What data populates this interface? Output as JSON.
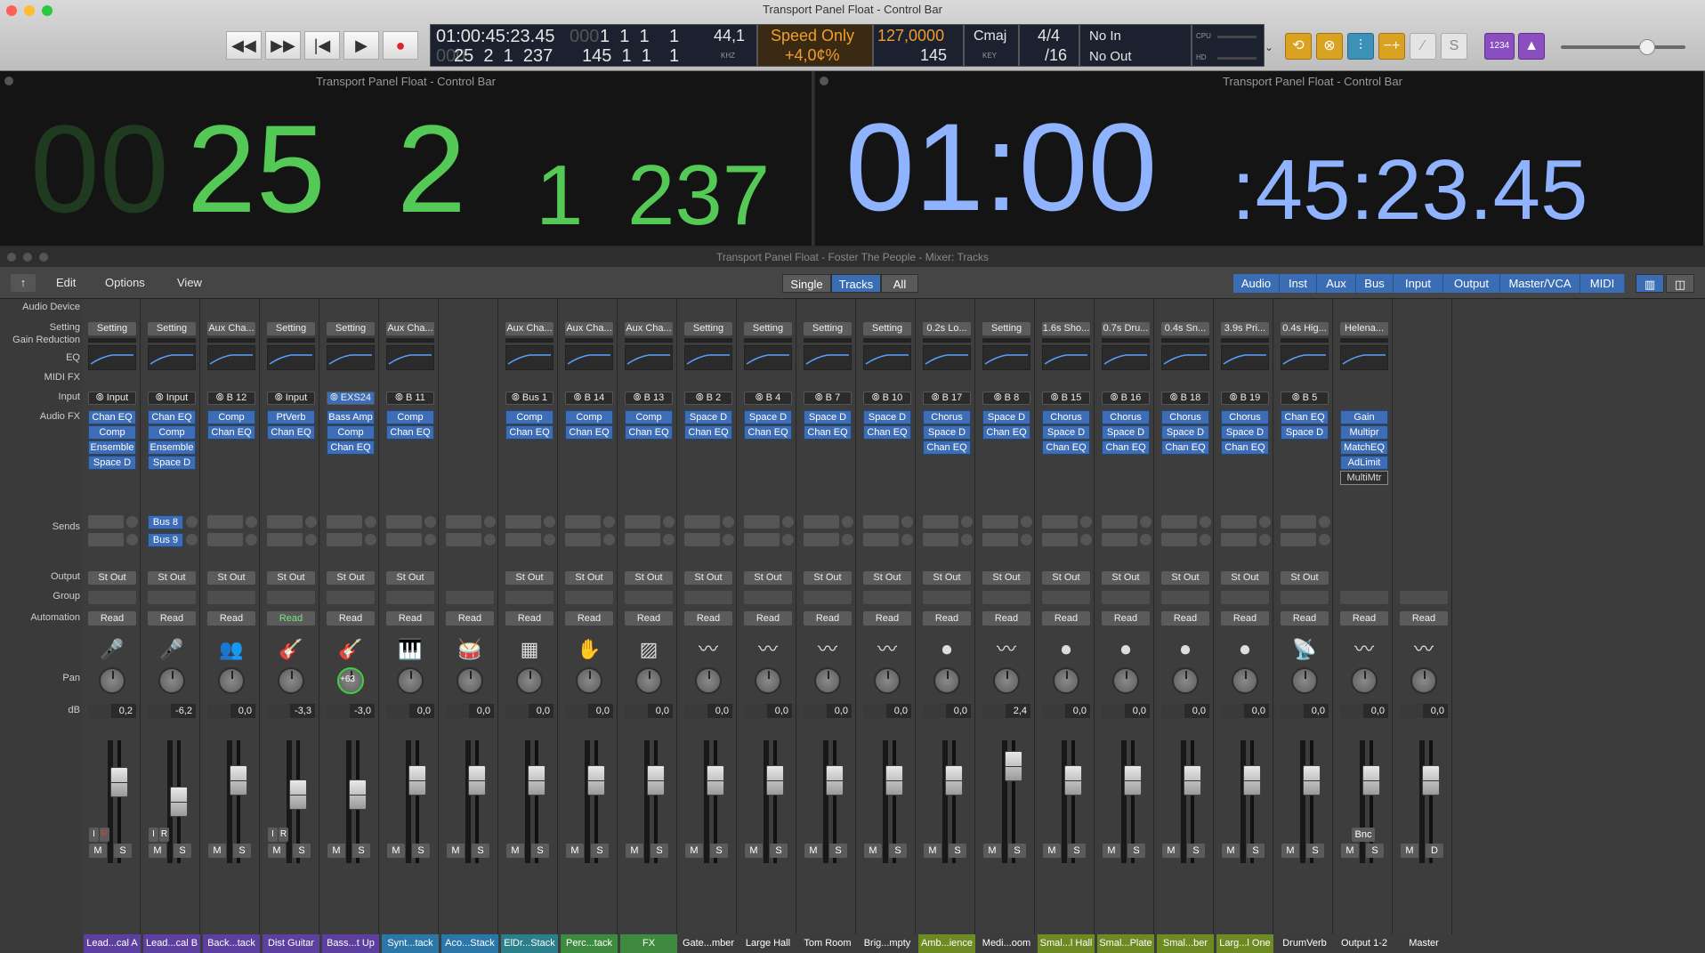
{
  "control_bar": {
    "title": "Transport Panel Float - Control Bar",
    "time": {
      "smpte": "01:00:45:23.45",
      "smpte_dim": "",
      "bar_top": "1  1  1",
      "bar_top_dim": "000",
      "bar_top_last": "1",
      "bar_bot": "145  1  1",
      "bar_bot_last": "1",
      "pos": "25  2  1  237",
      "pos_dim": "000"
    },
    "sample_rate": {
      "value": "44,1",
      "unit": "KHZ"
    },
    "speed": {
      "label": "Speed Only",
      "value": "+4,0¢%"
    },
    "tempo": {
      "top": "127,0000",
      "bottom": "145"
    },
    "key": {
      "value": "Cmaj",
      "label": "KEY"
    },
    "signature": {
      "top": "4/4",
      "bottom": "/16"
    },
    "midi": {
      "in": "No In",
      "out": "No Out"
    },
    "meters": {
      "cpu": "CPU",
      "hd": "HD"
    },
    "lcd_digits": "1234"
  },
  "float_left": {
    "title": "Transport Panel Float - Control Bar",
    "dim": "00",
    "bar": "25",
    "beat": "2",
    "div": "1",
    "tick": "237"
  },
  "float_right": {
    "title": "Transport Panel Float - Control Bar",
    "hours": "01:00",
    "rest": ":45:23.45"
  },
  "mixer": {
    "title": "Transport Panel Float - Foster The People - Mixer: Tracks",
    "menu": [
      "Edit",
      "Options",
      "View"
    ],
    "view_modes": [
      "Single",
      "Tracks",
      "All"
    ],
    "filters": [
      "Audio",
      "Inst",
      "Aux",
      "Bus",
      "Input",
      "Output",
      "Master/VCA",
      "MIDI"
    ],
    "row_labels": {
      "audio_device": "Audio Device",
      "setting": "Setting",
      "gain_reduction": "Gain Reduction",
      "eq": "EQ",
      "midi_fx": "MIDI FX",
      "input": "Input",
      "audio_fx": "Audio FX",
      "sends": "Sends",
      "output": "Output",
      "group": "Group",
      "automation": "Automation",
      "pan": "Pan",
      "db": "dB"
    },
    "sends": [
      "Bus 8",
      "Bus 9"
    ],
    "pan_display": "+63",
    "bnc": "Bnc",
    "channels": [
      {
        "name": "Lead...cal A",
        "setting": "Setting",
        "input": "Input",
        "fx": [
          "Chan EQ",
          "Comp",
          "Ensemble",
          "Space D"
        ],
        "out": "St Out",
        "auto": "Read",
        "db": "0,2",
        "color": "#5c3f9e"
      },
      {
        "name": "Lead...cal B",
        "setting": "Setting",
        "input": "Input",
        "fx": [
          "Chan EQ",
          "Comp",
          "Ensemble",
          "Space D"
        ],
        "out": "St Out",
        "auto": "Read",
        "db": "-6,2",
        "color": "#5c3f9e"
      },
      {
        "name": "Back...tack",
        "setting": "Aux Cha...",
        "input": "B 12",
        "fx": [
          "Comp",
          "Chan EQ"
        ],
        "out": "St Out",
        "auto": "Read",
        "db": "0,0",
        "color": "#5c3f9e"
      },
      {
        "name": "Dist Guitar",
        "setting": "Setting",
        "input": "Input",
        "fx": [
          "PtVerb",
          "Chan EQ"
        ],
        "out": "St Out",
        "auto": "Read",
        "db": "-3,3",
        "color": "#5c3f9e"
      },
      {
        "name": "Bass...t Up",
        "setting": "Setting",
        "input": "EXS24",
        "fx": [
          "Bass Amp",
          "Comp",
          "Chan EQ"
        ],
        "out": "St Out",
        "auto": "Read",
        "db": "-3,0",
        "color": "#5c3f9e"
      },
      {
        "name": "Synt...tack",
        "setting": "Aux Cha...",
        "input": "B 11",
        "fx": [
          "Comp",
          "Chan EQ"
        ],
        "out": "St Out",
        "auto": "Read",
        "db": "0,0",
        "color": "#2a77a8"
      },
      {
        "name": "Aco...Stack",
        "setting": "",
        "input": "",
        "fx": [],
        "out": "",
        "auto": "Read",
        "db": "0,0",
        "color": "#2a77a8"
      },
      {
        "name": "ElDr...Stack",
        "setting": "Aux Cha...",
        "input": "Bus 1",
        "fx": [
          "Comp",
          "Chan EQ"
        ],
        "out": "St Out",
        "auto": "Read",
        "db": "0,0",
        "color": "#2a7f8a"
      },
      {
        "name": "Perc...tack",
        "setting": "Aux Cha...",
        "input": "B 14",
        "fx": [
          "Comp",
          "Chan EQ"
        ],
        "out": "St Out",
        "auto": "Read",
        "db": "0,0",
        "color": "#3e8a3e"
      },
      {
        "name": "FX",
        "setting": "Aux Cha...",
        "input": "B 13",
        "fx": [
          "Comp",
          "Chan EQ"
        ],
        "out": "St Out",
        "auto": "Read",
        "db": "0,0",
        "color": "#3e8a3e"
      },
      {
        "name": "Gate...mber",
        "setting": "Setting",
        "input": "B 2",
        "fx": [
          "Space D",
          "Chan EQ"
        ],
        "out": "St Out",
        "auto": "Read",
        "db": "0,0",
        "color": "#3c3c3c"
      },
      {
        "name": "Large Hall",
        "setting": "Setting",
        "input": "B 4",
        "fx": [
          "Space D",
          "Chan EQ"
        ],
        "out": "St Out",
        "auto": "Read",
        "db": "0,0",
        "color": "#3c3c3c"
      },
      {
        "name": "Tom Room",
        "setting": "Setting",
        "input": "B 7",
        "fx": [
          "Space D",
          "Chan EQ"
        ],
        "out": "St Out",
        "auto": "Read",
        "db": "0,0",
        "color": "#3c3c3c"
      },
      {
        "name": "Brig...mpty",
        "setting": "Setting",
        "input": "B 10",
        "fx": [
          "Space D",
          "Chan EQ"
        ],
        "out": "St Out",
        "auto": "Read",
        "db": "0,0",
        "color": "#3c3c3c"
      },
      {
        "name": "Amb...ience",
        "setting": "0.2s Lo...",
        "input": "B 17",
        "fx": [
          "Chorus",
          "Space D",
          "Chan EQ"
        ],
        "out": "St Out",
        "auto": "Read",
        "db": "0,0",
        "color": "#6e8a22"
      },
      {
        "name": "Medi...oom",
        "setting": "Setting",
        "input": "B 8",
        "fx": [
          "Space D",
          "Chan EQ"
        ],
        "out": "St Out",
        "auto": "Read",
        "db": "2,4",
        "color": "#3c3c3c"
      },
      {
        "name": "Smal...l Hall",
        "setting": "1.6s Sho...",
        "input": "B 15",
        "fx": [
          "Chorus",
          "Space D",
          "Chan EQ"
        ],
        "out": "St Out",
        "auto": "Read",
        "db": "0,0",
        "color": "#6e8a22"
      },
      {
        "name": "Smal...Plate",
        "setting": "0.7s Dru...",
        "input": "B 16",
        "fx": [
          "Chorus",
          "Space D",
          "Chan EQ"
        ],
        "out": "St Out",
        "auto": "Read",
        "db": "0,0",
        "color": "#6e8a22"
      },
      {
        "name": "Smal...ber",
        "setting": "0.4s Sn...",
        "input": "B 18",
        "fx": [
          "Chorus",
          "Space D",
          "Chan EQ"
        ],
        "out": "St Out",
        "auto": "Read",
        "db": "0,0",
        "color": "#6e8a22"
      },
      {
        "name": "Larg...l One",
        "setting": "3.9s Pri...",
        "input": "B 19",
        "fx": [
          "Chorus",
          "Space D",
          "Chan EQ"
        ],
        "out": "St Out",
        "auto": "Read",
        "db": "0,0",
        "color": "#6e8a22"
      },
      {
        "name": "DrumVerb",
        "setting": "0.4s Hig...",
        "input": "B 5",
        "fx": [
          "Chan EQ",
          "Space D"
        ],
        "out": "St Out",
        "auto": "Read",
        "db": "0,0",
        "color": "#3c3c3c"
      },
      {
        "name": "Output 1-2",
        "setting": "Helena...",
        "input": "",
        "fx": [
          "Gain",
          "Multipr",
          "MatchEQ",
          "AdLimit",
          "MultiMtr"
        ],
        "out": "",
        "auto": "Read",
        "db": "0,0",
        "color": "#3c3c3c"
      },
      {
        "name": "Master",
        "setting": "",
        "input": "",
        "fx": [],
        "out": "",
        "auto": "Read",
        "db": "0,0",
        "color": "#3c3c3c"
      }
    ],
    "ms": {
      "m": "M",
      "s": "S",
      "d": "D",
      "i": "I",
      "r": "R"
    }
  }
}
